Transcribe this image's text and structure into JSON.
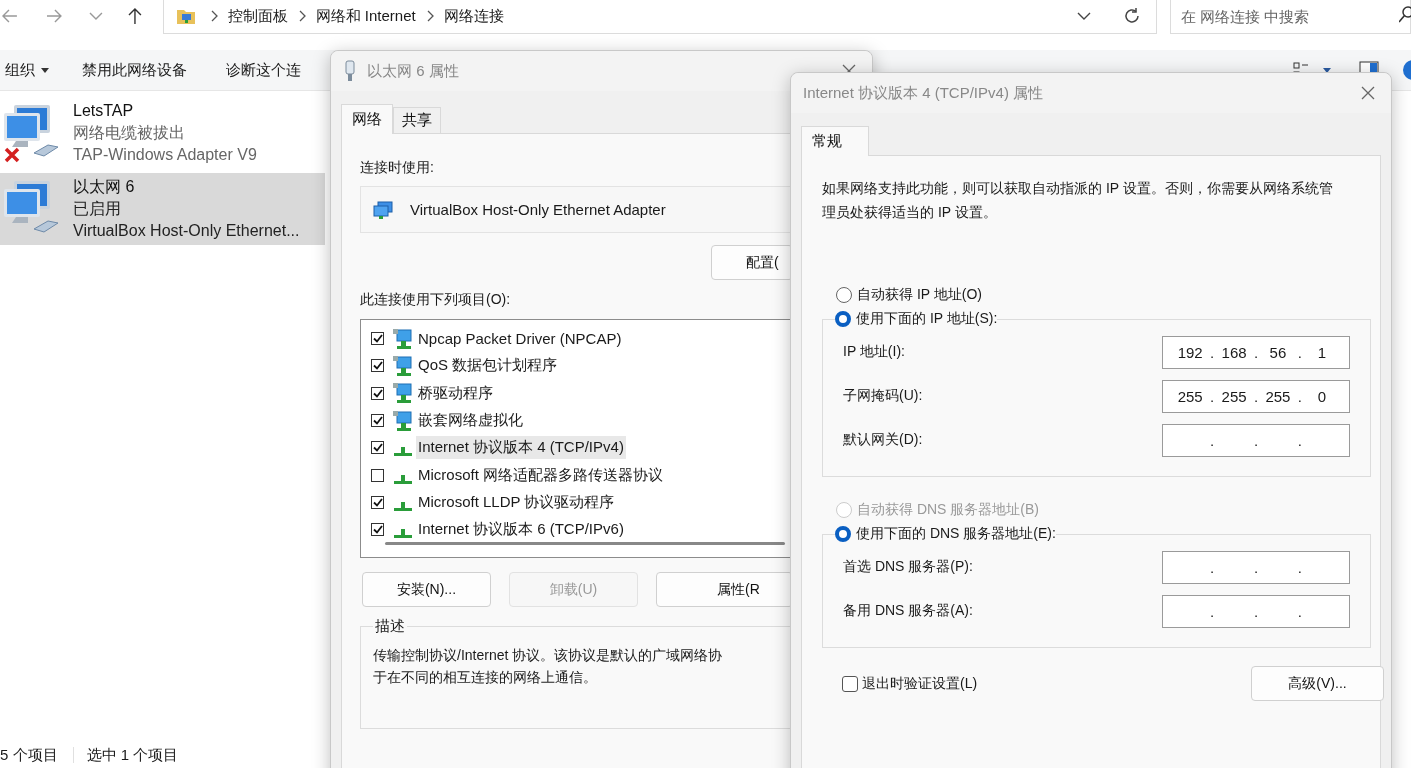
{
  "explorer": {
    "breadcrumb": [
      "控制面板",
      "网络和 Internet",
      "网络连接"
    ],
    "search": {
      "placeholder": "在 网络连接 中搜索"
    },
    "toolbar": [
      {
        "label": "组织",
        "kind": "menu"
      },
      {
        "label": "禁用此网络设备",
        "kind": "command"
      },
      {
        "label": "诊断这个连",
        "kind": "command"
      }
    ],
    "connections": [
      {
        "name": "LetsTAP",
        "status": "网络电缆被拔出",
        "device": "TAP-Windows Adapter V9",
        "disconnected": true,
        "selected": false
      },
      {
        "name": "以太网 6",
        "status": "已启用",
        "device": "VirtualBox Host-Only Ethernet...",
        "disconnected": false,
        "selected": true
      }
    ],
    "status_bar": [
      "5 个项目",
      "选中 1 个项目"
    ]
  },
  "adapter_dialog": {
    "title": "以太网 6 属性",
    "tabs": [
      {
        "label": "网络",
        "selected": true
      },
      {
        "label": "共享",
        "selected": false
      }
    ],
    "connect_using_label": "连接时使用:",
    "adapter": "VirtualBox Host-Only Ethernet Adapter",
    "configure_button": "配置(",
    "items_label": "此连接使用下列项目(O):",
    "items": [
      {
        "label": "Npcap Packet Driver (NPCAP)",
        "kind": "service",
        "checked": true,
        "selected": false
      },
      {
        "label": "QoS 数据包计划程序",
        "kind": "service",
        "checked": true,
        "selected": false
      },
      {
        "label": "桥驱动程序",
        "kind": "service",
        "checked": true,
        "selected": false
      },
      {
        "label": "嵌套网络虚拟化",
        "kind": "service",
        "checked": true,
        "selected": false
      },
      {
        "label": "Internet 协议版本 4 (TCP/IPv4)",
        "kind": "protocol",
        "checked": true,
        "selected": true
      },
      {
        "label": "Microsoft 网络适配器多路传送器协议",
        "kind": "protocol",
        "checked": false,
        "selected": false
      },
      {
        "label": "Microsoft LLDP 协议驱动程序",
        "kind": "protocol",
        "checked": true,
        "selected": false
      },
      {
        "label": "Internet 协议版本 6 (TCP/IPv6)",
        "kind": "protocol",
        "checked": true,
        "selected": false
      }
    ],
    "buttons": [
      {
        "label": "安装(N)...",
        "disabled": false
      },
      {
        "label": "卸载(U)",
        "disabled": true
      },
      {
        "label": "属性(R",
        "disabled": false
      }
    ],
    "description_title": "描述",
    "description_lines": [
      "传输控制协议/Internet 协议。该协议是默认的广域网络协",
      "于在不同的相互连接的网络上通信。"
    ]
  },
  "ipv4_dialog": {
    "title": "Internet 协议版本 4 (TCP/IPv4) 属性",
    "tabs": [
      {
        "label": "常规",
        "selected": true
      }
    ],
    "intro": "如果网络支持此功能，则可以获取自动指派的 IP 设置。否则，你需要从网络系统管理员处获得适当的 IP 设置。",
    "octet_separator": ".",
    "sections": [
      {
        "auto_option": {
          "label": "自动获得 IP 地址(O)",
          "selected": false,
          "disabled": false
        },
        "manual_option": {
          "label": "使用下面的 IP 地址(S):",
          "selected": true,
          "disabled": false
        },
        "fields": [
          {
            "label": "IP 地址(I):",
            "octets": [
              "192",
              "168",
              "56",
              "1"
            ]
          },
          {
            "label": "子网掩码(U):",
            "octets": [
              "255",
              "255",
              "255",
              "0"
            ]
          },
          {
            "label": "默认网关(D):"
          }
        ]
      },
      {
        "auto_option": {
          "label": "自动获得 DNS 服务器地址(B)",
          "selected": false,
          "disabled": true
        },
        "manual_option": {
          "label": "使用下面的 DNS 服务器地址(E):",
          "selected": true,
          "disabled": false
        },
        "fields": [
          {
            "label": "首选 DNS 服务器(P):"
          },
          {
            "label": "备用 DNS 服务器(A):"
          }
        ]
      }
    ],
    "validate_checkbox": {
      "label": "退出时验证设置(L)",
      "checked": false
    },
    "advanced_button": "高级(V)..."
  }
}
